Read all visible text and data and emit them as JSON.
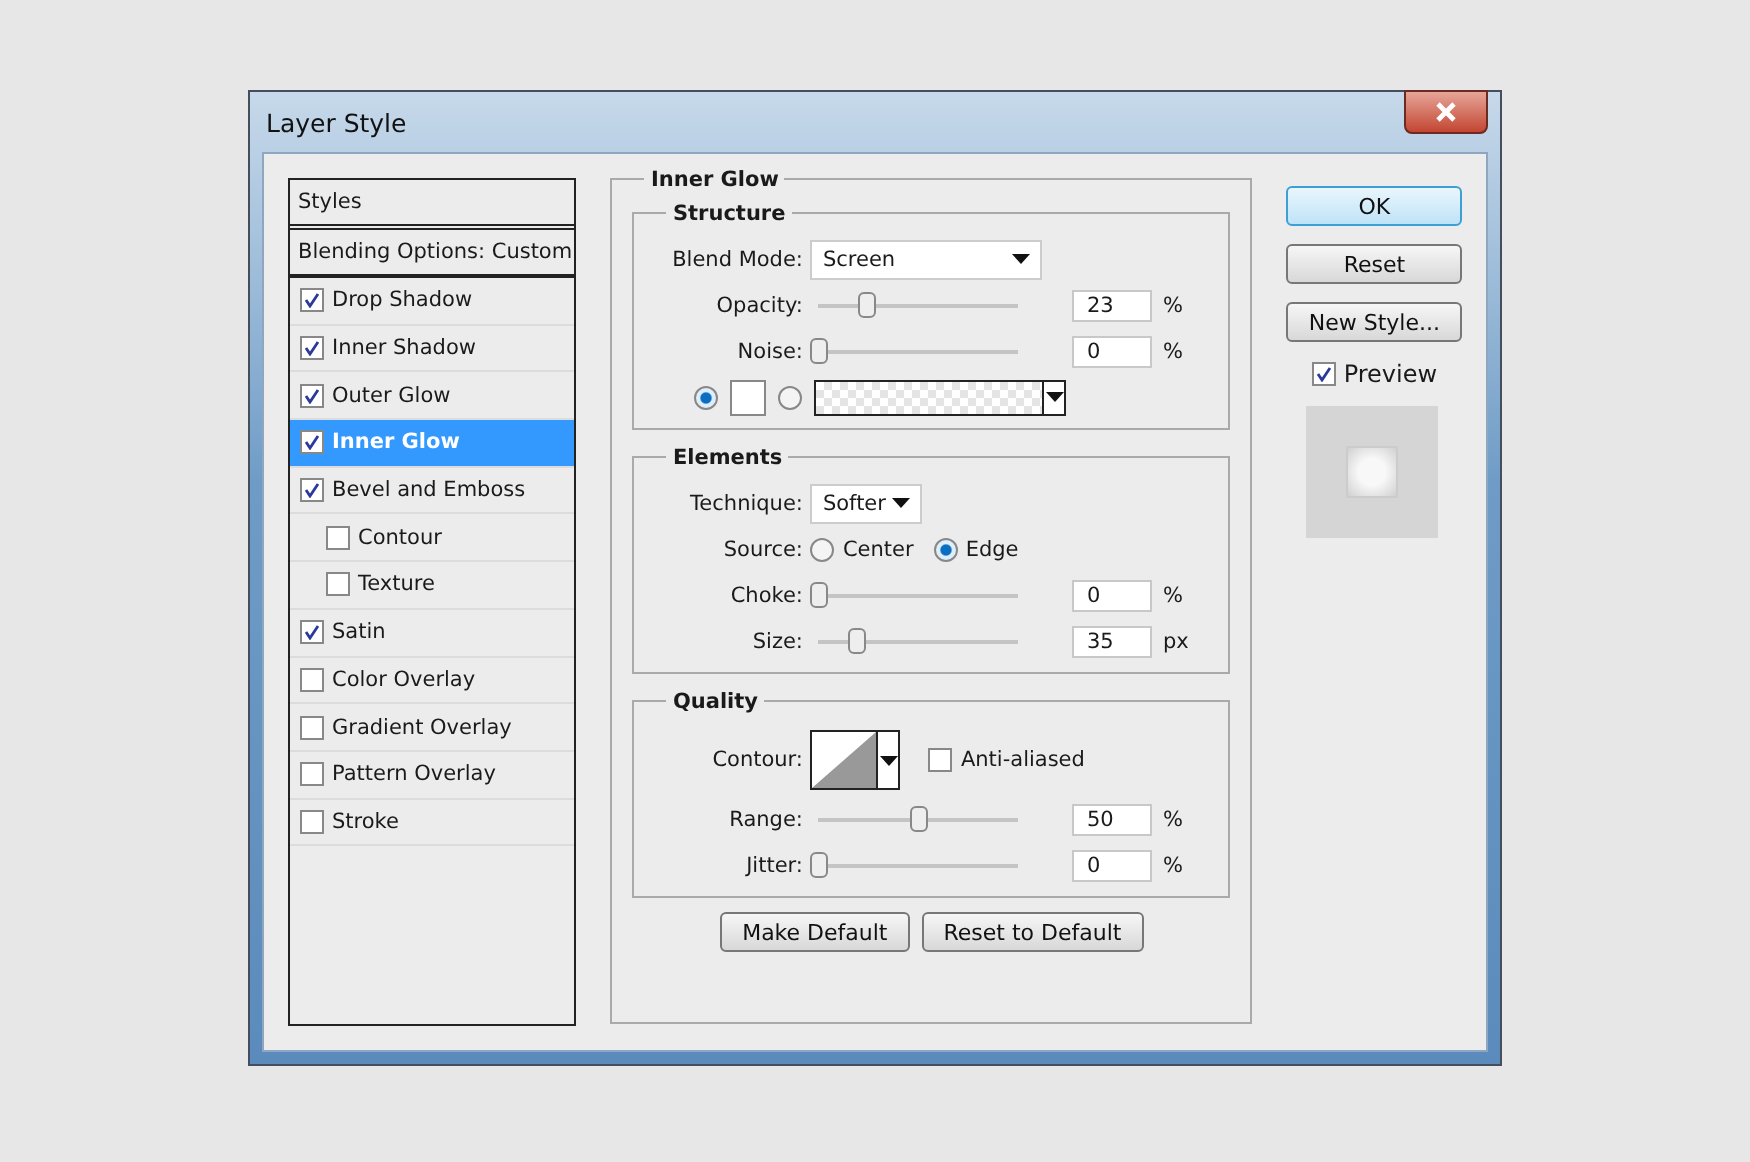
{
  "window": {
    "title": "Layer Style"
  },
  "styles": {
    "header": "Styles",
    "blending": "Blending Options: Custom",
    "items": [
      {
        "label": "Drop Shadow",
        "checked": true,
        "selected": false
      },
      {
        "label": "Inner Shadow",
        "checked": true,
        "selected": false
      },
      {
        "label": "Outer Glow",
        "checked": true,
        "selected": false
      },
      {
        "label": "Inner Glow",
        "checked": true,
        "selected": true
      },
      {
        "label": "Bevel and Emboss",
        "checked": true,
        "selected": false,
        "children": [
          {
            "label": "Contour",
            "checked": false,
            "selected": false
          },
          {
            "label": "Texture",
            "checked": false,
            "selected": false
          }
        ]
      },
      {
        "label": "Satin",
        "checked": true,
        "selected": false
      },
      {
        "label": "Color Overlay",
        "checked": false,
        "selected": false
      },
      {
        "label": "Gradient Overlay",
        "checked": false,
        "selected": false
      },
      {
        "label": "Pattern Overlay",
        "checked": false,
        "selected": false
      },
      {
        "label": "Stroke",
        "checked": false,
        "selected": false
      }
    ]
  },
  "panel": {
    "title": "Inner Glow",
    "sections": [
      {
        "title": "Structure",
        "rows": [
          {
            "kind": "select",
            "label": "Blend Mode:",
            "value": "Screen"
          },
          {
            "kind": "slider",
            "label": "Opacity:",
            "level": 0.24,
            "value": "23",
            "unit": "%"
          },
          {
            "kind": "slider",
            "label": "Noise:",
            "level": 0,
            "value": "0",
            "unit": "%"
          },
          {
            "kind": "fill",
            "color_selected": true,
            "gradient_selected": false
          }
        ]
      },
      {
        "title": "Elements",
        "rows": [
          {
            "kind": "select",
            "label": "Technique:",
            "value": "Softer"
          },
          {
            "kind": "radio",
            "label": "Source:",
            "options": [
              {
                "label": "Center",
                "selected": false
              },
              {
                "label": "Edge",
                "selected": true
              }
            ]
          },
          {
            "kind": "slider",
            "label": "Choke:",
            "level": 0,
            "value": "0",
            "unit": "%"
          },
          {
            "kind": "slider",
            "label": "Size:",
            "level": 0.19,
            "value": "35",
            "unit": "px"
          }
        ]
      },
      {
        "title": "Quality",
        "rows": [
          {
            "kind": "contour",
            "label": "Contour:",
            "option": "Anti-aliased",
            "checked": false
          },
          {
            "kind": "slider",
            "label": "Range:",
            "level": 0.5,
            "value": "50",
            "unit": "%"
          },
          {
            "kind": "slider",
            "label": "Jitter:",
            "level": 0,
            "value": "0",
            "unit": "%"
          }
        ]
      }
    ],
    "buttons": [
      "Make Default",
      "Reset to Default"
    ]
  },
  "actions": [
    {
      "label": "OK",
      "default": true
    },
    {
      "label": "Reset",
      "default": false
    },
    {
      "label": "New Style...",
      "default": false
    }
  ],
  "preview": {
    "label": "Preview",
    "checked": true
  }
}
